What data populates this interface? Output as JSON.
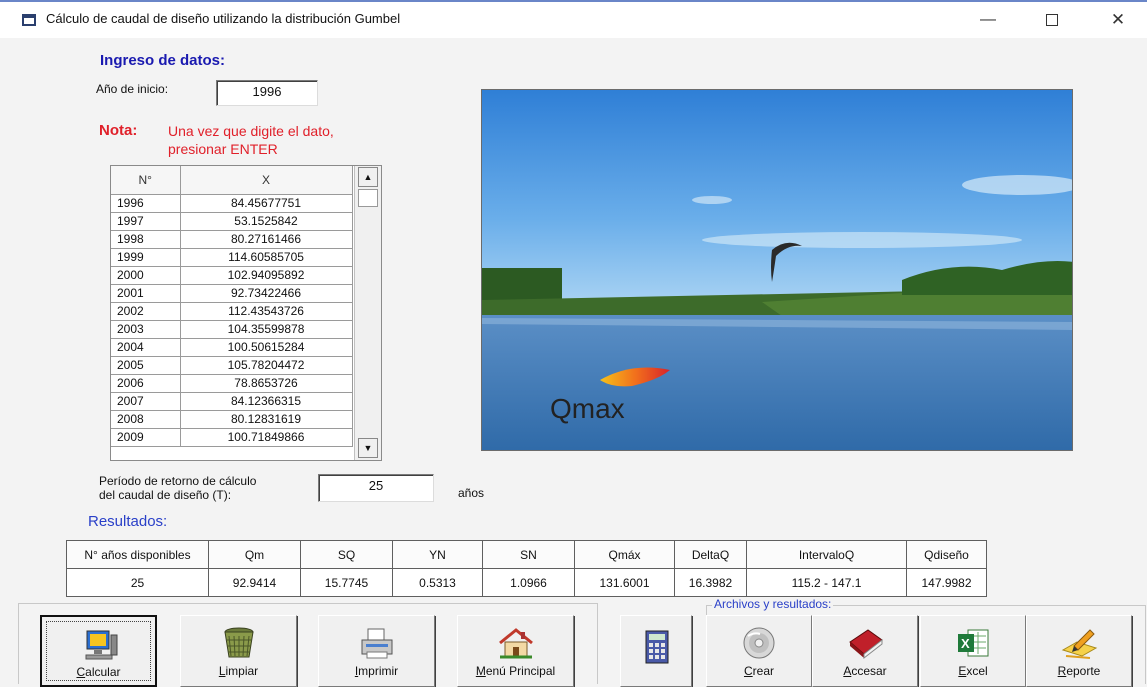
{
  "window": {
    "title": "Cálculo de caudal de diseño utilizando la distribución Gumbel",
    "min_glyph": "—",
    "close_glyph": "✕"
  },
  "input": {
    "heading": "Ingreso de datos:",
    "start_year_label": "Año de inicio:",
    "start_year_value": "1996",
    "note_label": "Nota:",
    "note_text_line1": "Una vez que digite el dato,",
    "note_text_line2": "presionar ENTER"
  },
  "grid": {
    "col_n": "N°",
    "col_x": "X",
    "rows": [
      {
        "year": "1996",
        "x": "84.45677751"
      },
      {
        "year": "1997",
        "x": "53.1525842"
      },
      {
        "year": "1998",
        "x": "80.27161466"
      },
      {
        "year": "1999",
        "x": "114.60585705"
      },
      {
        "year": "2000",
        "x": "102.94095892"
      },
      {
        "year": "2001",
        "x": "92.73422466"
      },
      {
        "year": "2002",
        "x": "112.43543726"
      },
      {
        "year": "2003",
        "x": "104.35599878"
      },
      {
        "year": "2004",
        "x": "100.50615284"
      },
      {
        "year": "2005",
        "x": "105.78204472"
      },
      {
        "year": "2006",
        "x": "78.8653726"
      },
      {
        "year": "2007",
        "x": "84.12366315"
      },
      {
        "year": "2008",
        "x": "80.12831619"
      },
      {
        "year": "2009",
        "x": "100.71849866"
      }
    ]
  },
  "period": {
    "label_line1": "Período de retorno de cálculo",
    "label_line2": "del caudal de diseño (T):",
    "value": "25",
    "unit": "años"
  },
  "image": {
    "caption": "Qmax"
  },
  "results": {
    "heading": "Resultados:",
    "headers": [
      "N° años disponibles",
      "Qm",
      "SQ",
      "YN",
      "SN",
      "Qmáx",
      "DeltaQ",
      "IntervaloQ",
      "Qdiseño"
    ],
    "values": [
      "25",
      "92.9414",
      "15.7745",
      "0.5313",
      "1.0966",
      "131.6001",
      "16.3982",
      "115.2 - 147.1",
      "147.9982"
    ]
  },
  "buttons": {
    "calcular": {
      "u": "C",
      "rest": "alcular"
    },
    "limpiar": {
      "u": "L",
      "rest": "impiar"
    },
    "imprimir": {
      "u": "I",
      "rest": "mprimir"
    },
    "menu": {
      "u": "M",
      "rest": "enú Principal"
    },
    "crear": {
      "u": "C",
      "rest": "rear"
    },
    "accesar": {
      "u": "A",
      "rest": "ccesar"
    },
    "excel": {
      "u": "E",
      "rest": "xcel"
    },
    "reporte": {
      "u": "R",
      "rest": "eporte"
    }
  },
  "files_group": {
    "label": "Archivos y resultados:"
  },
  "colors": {
    "heading_blue": "#1a1ab0",
    "note_red": "#e0202a",
    "results_blue": "#2a40c8"
  }
}
